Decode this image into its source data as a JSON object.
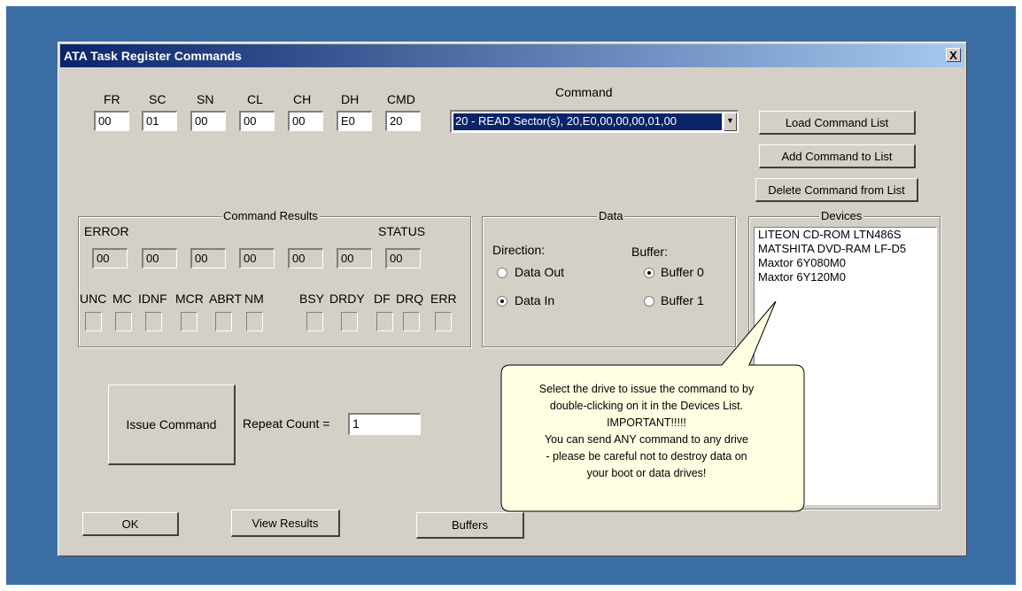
{
  "window": {
    "title": "ATA Task Register Commands",
    "close_glyph": "X"
  },
  "registers": [
    {
      "label": "FR",
      "value": "00"
    },
    {
      "label": "SC",
      "value": "01"
    },
    {
      "label": "SN",
      "value": "00"
    },
    {
      "label": "CL",
      "value": "00"
    },
    {
      "label": "CH",
      "value": "00"
    },
    {
      "label": "DH",
      "value": "E0"
    },
    {
      "label": "CMD",
      "value": "20"
    }
  ],
  "command": {
    "label": "Command",
    "selected": "20 - READ Sector(s), 20,E0,00,00,00,01,00"
  },
  "buttons": {
    "load_list": "Load Command List",
    "add_to_list": "Add Command to List",
    "delete_from_list": "Delete Command from List",
    "issue": "Issue Command",
    "ok": "OK",
    "view_results": "View Results",
    "buffers": "Buffers"
  },
  "results": {
    "title": "Command Results",
    "error_label": "ERROR",
    "status_label": "STATUS",
    "values": [
      "00",
      "00",
      "00",
      "00",
      "00",
      "00",
      "00"
    ],
    "error_bits": [
      "UNC",
      "MC",
      "IDNF",
      "MCR",
      "ABRT",
      "NM"
    ],
    "status_bits": [
      "BSY",
      "DRDY",
      "DF",
      "DRQ",
      "ERR"
    ]
  },
  "data_group": {
    "title": "Data",
    "direction_label": "Direction:",
    "buffer_label": "Buffer:",
    "data_out": "Data Out",
    "data_in": "Data In",
    "buffer0": "Buffer 0",
    "buffer1": "Buffer 1"
  },
  "devices": {
    "title": "Devices",
    "items": [
      "LITEON CD-ROM LTN486S",
      "MATSHITA DVD-RAM LF-D5",
      "Maxtor 6Y080M0",
      "Maxtor 6Y120M0"
    ]
  },
  "repeat": {
    "label": "Repeat Count =",
    "value": "1"
  },
  "tooltip": {
    "text": "Select the drive to issue the command to by\ndouble-clicking on it in the Devices List.\nIMPORTANT!!!!!\nYou can send ANY command to any drive\n- please be careful not to destroy data on\nyour boot or data drives!"
  }
}
